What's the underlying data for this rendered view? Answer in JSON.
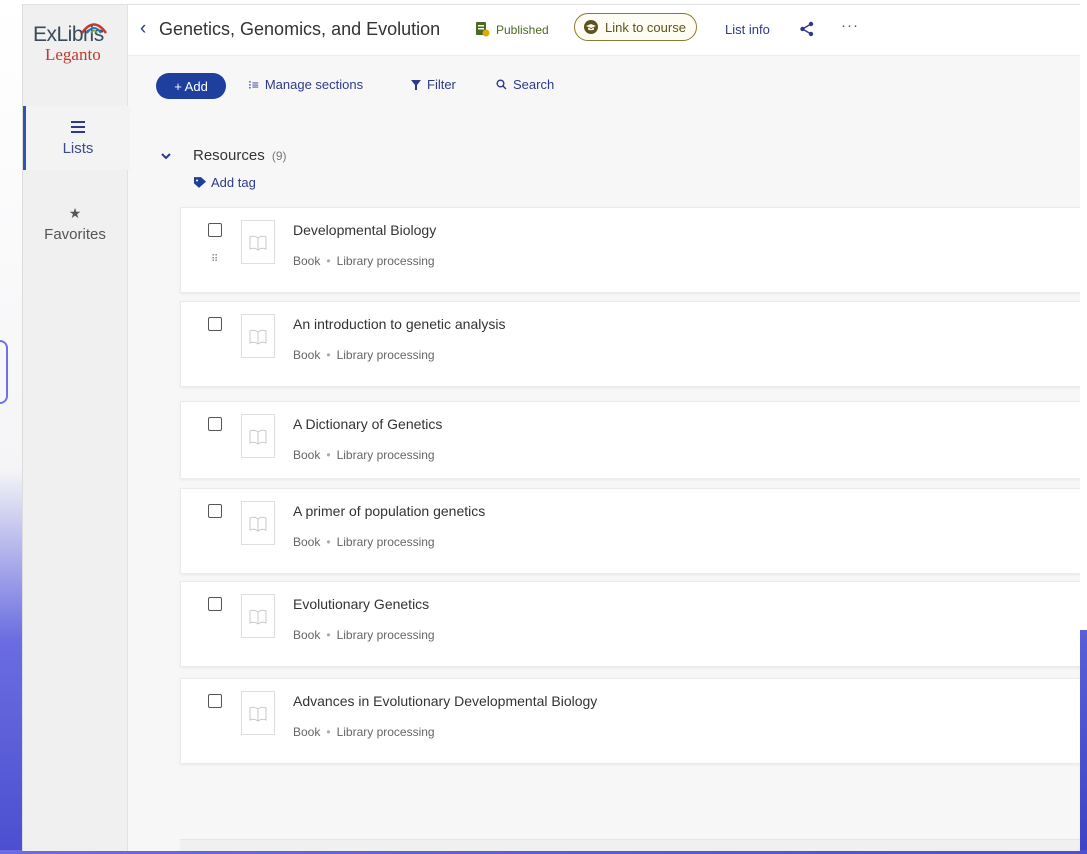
{
  "brand": {
    "name": "ExLibris",
    "product": "Leganto"
  },
  "nav": {
    "items": [
      {
        "label": "Lists",
        "icon": "list-icon",
        "active": true
      },
      {
        "label": "Favorites",
        "icon": "star-icon",
        "active": false
      }
    ]
  },
  "header": {
    "title": "Genetics, Genomics, and Evolution",
    "status": "Published",
    "link_course": "Link to course",
    "list_info": "List info"
  },
  "toolbar": {
    "add": "+ Add",
    "manage_sections": "Manage sections",
    "filter": "Filter",
    "search": "Search"
  },
  "section": {
    "title": "Resources",
    "count": "(9)",
    "add_tag": "Add tag"
  },
  "items": [
    {
      "title": "Developmental Biology",
      "type": "Book",
      "status": "Library processing"
    },
    {
      "title": "An introduction to genetic analysis",
      "type": "Book",
      "status": "Library processing"
    },
    {
      "title": "A Dictionary of Genetics",
      "type": "Book",
      "status": "Library processing"
    },
    {
      "title": "A primer of population genetics",
      "type": "Book",
      "status": "Library processing"
    },
    {
      "title": "Evolutionary Genetics",
      "type": "Book",
      "status": "Library processing"
    },
    {
      "title": "Advances in Evolutionary Developmental Biology",
      "type": "Book",
      "status": "Library processing"
    }
  ],
  "colors": {
    "accent": "#1f3f9e",
    "link": "#2d3a8c",
    "published": "#4a6a1f",
    "course_border": "#8a7a30"
  }
}
